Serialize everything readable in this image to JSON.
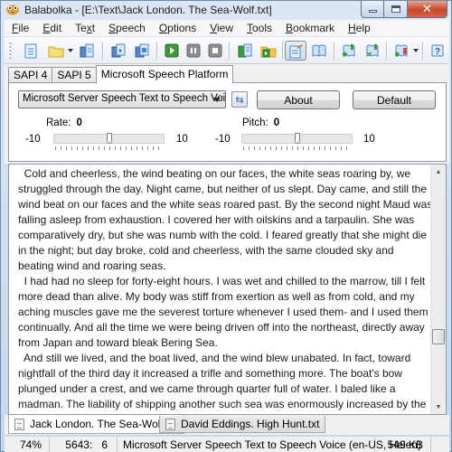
{
  "window": {
    "title": "Balabolka - [E:\\Text\\Jack London. The Sea-Wolf.txt]",
    "minimize_label": "",
    "maximize_label": "",
    "close_label": "✕"
  },
  "menu": [
    {
      "label": "File",
      "accel": "F",
      "rest": "ile"
    },
    {
      "label": "Edit",
      "accel": "E",
      "rest": "dit"
    },
    {
      "label": "Text",
      "pre": "Te",
      "accel": "x",
      "rest": "t"
    },
    {
      "label": "Speech",
      "accel": "S",
      "rest": "peech"
    },
    {
      "label": "Options",
      "accel": "O",
      "rest": "ptions"
    },
    {
      "label": "View",
      "accel": "V",
      "rest": "iew"
    },
    {
      "label": "Tools",
      "accel": "T",
      "rest": "ools"
    },
    {
      "label": "Bookmark",
      "accel": "B",
      "rest": "ookmark"
    },
    {
      "label": "Help",
      "accel": "H",
      "rest": "elp"
    }
  ],
  "toolbar": {
    "buttons": [
      "new",
      "open",
      "open-dropdown",
      "save",
      "read-clipboard",
      "save-audio",
      "play",
      "pause",
      "stop",
      "export-audio",
      "open-audio-folder",
      "show-editor",
      "dictionary",
      "add-bookmark",
      "next-bookmark",
      "bookmark-list",
      "help"
    ]
  },
  "engine_tabs": [
    {
      "label": "SAPI 4",
      "selected": false
    },
    {
      "label": "SAPI 5",
      "selected": false
    },
    {
      "label": "Microsoft Speech Platform",
      "selected": true
    }
  ],
  "voice_panel": {
    "voice_selected": "Microsoft Server Speech Text to Speech Voice (e",
    "about_label": "About",
    "default_label": "Default",
    "refresh_glyph": "⇆",
    "rate": {
      "label": "Rate:",
      "value": "0",
      "min": "-10",
      "max": "10",
      "position_fraction": 0.5
    },
    "pitch": {
      "label": "Pitch:",
      "value": "0",
      "min": "-10",
      "max": "10",
      "position_fraction": 0.5
    }
  },
  "editor": {
    "lines": [
      "  Cold and cheerless, the wind beating on our faces, the white seas roaring by, we",
      "struggled through the day. Night came, but neither of us slept. Day came, and still the",
      "wind beat on our faces and the white seas roared past. By the second night Maud was",
      "falling asleep from exhaustion. I covered her with oilskins and a tarpaulin. She was",
      "comparatively dry, but she was numb with the cold. I feared greatly that she might die",
      "in the night; but day broke, cold and cheerless, with the same clouded sky and",
      "beating wind and roaring seas.",
      "  I had had no sleep for forty-eight hours. I was wet and chilled to the marrow, till I felt",
      "more dead than alive. My body was stiff from exertion as well as from cold, and my",
      "aching muscles gave me the severest torture whenever I used them- and I used them",
      "continually. And all the time we were being driven off into the northeast, directly away",
      "from Japan and toward bleak Bering Sea.",
      "  And still we lived, and the boat lived, and the wind blew unabated. In fact, toward",
      "nightfall of the third day it increased a trifle and something more. The boat's bow",
      "plunged under a crest, and we came through quarter full of water. I baled like a",
      "madman. The liability of shipping another such sea was enormously increased by the"
    ],
    "scroll_position_fraction": 0.73
  },
  "doc_tabs": [
    {
      "label": "Jack London. The Sea-Wolf.txt",
      "active": true
    },
    {
      "label": "David Eddings. High Hunt.txt",
      "active": false
    }
  ],
  "statusbar": {
    "zoom": "74%",
    "position": "5643:   6",
    "voice": "Microsoft Server Speech Text to Speech Voice (en-US, Helen)",
    "size": "549 KB"
  },
  "colors": {
    "play_green": "#3a9a3a",
    "frame_blue": "#c4d7ec",
    "close_red": "#c9462c"
  }
}
